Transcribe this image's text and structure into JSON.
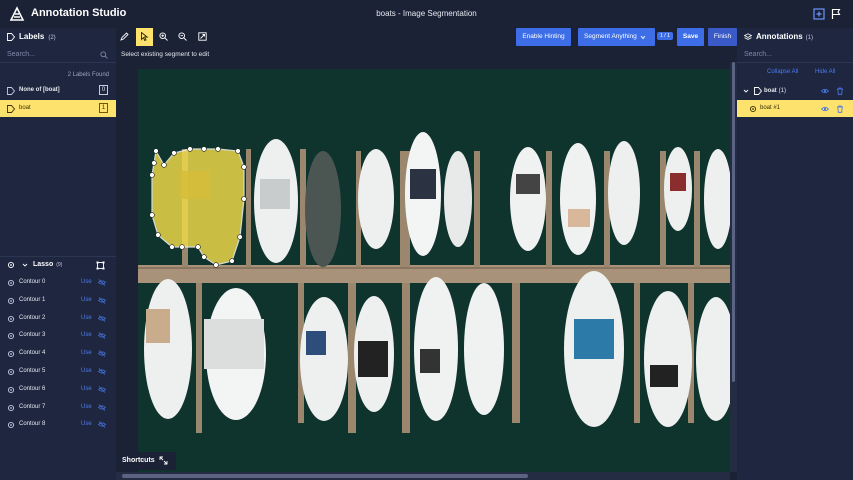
{
  "app": {
    "title": "Annotation Studio",
    "document_title": "boats - Image Segmentation"
  },
  "labels_panel": {
    "title": "Labels",
    "count": "(2)",
    "search_placeholder": "Search...",
    "found_text": "2 Labels Found",
    "items": [
      {
        "name": "None of [boat]",
        "key": "0",
        "selected": false
      },
      {
        "name": "boat",
        "key": "1",
        "selected": true
      }
    ]
  },
  "lasso_panel": {
    "title": "Lasso",
    "count": "(9)",
    "use_label": "Use",
    "contours": [
      "Contour 0",
      "Contour 1",
      "Contour 2",
      "Contour 3",
      "Contour 4",
      "Contour 5",
      "Contour 6",
      "Contour 7",
      "Contour 8"
    ]
  },
  "toolbar": {
    "enable_hinting": "Enable Hinting",
    "segment_anything": "Segment Anything",
    "counter": "1 / 1",
    "save": "Save",
    "finish": "Finish",
    "tooltip": "Select existing segment to edit",
    "tools": [
      "pen-icon",
      "pointer-icon",
      "zoom-in-icon",
      "zoom-out-icon",
      "fit-icon"
    ],
    "active_tool": "pointer-icon"
  },
  "shortcuts": {
    "label": "Shortcuts"
  },
  "annotations_panel": {
    "title": "Annotations",
    "count": "(1)",
    "search_placeholder": "Search...",
    "collapse_all": "Collapse All",
    "hide_all": "Hide All",
    "group": {
      "name": "boat",
      "count": "(1)"
    },
    "items": [
      {
        "name": "boat #1",
        "selected": true
      }
    ]
  },
  "colors": {
    "background": "#1b2236",
    "panel": "#1f2740",
    "accent": "#3d6ee8",
    "selection": "#fde36e",
    "water": "#0f2e28"
  }
}
